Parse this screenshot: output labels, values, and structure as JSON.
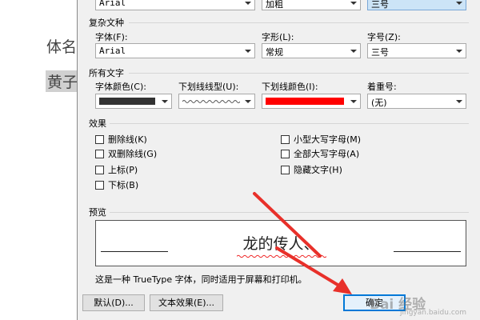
{
  "document": {
    "line1": "体名",
    "line2": "黄子"
  },
  "dialog": {
    "top_row": {
      "font_value": "Arial",
      "style_value": "加粗",
      "size_value": "三号"
    },
    "complex_script": {
      "title": "复杂文种",
      "font_label": "字体(F):",
      "font_value": "Arial",
      "style_label": "字形(L):",
      "style_value": "常规",
      "size_label": "字号(Z):",
      "size_value": "三号"
    },
    "all_text": {
      "title": "所有文字",
      "font_color_label": "字体颜色(C):",
      "underline_type_label": "下划线线型(U):",
      "underline_color_label": "下划线颜色(I):",
      "emphasis_label": "着重号:",
      "emphasis_value": "(无)",
      "font_color": "#333333",
      "underline_color": "#ff0000"
    },
    "effects": {
      "title": "效果",
      "strikethrough": "删除线(K)",
      "double_strikethrough": "双删除线(G)",
      "superscript": "上标(P)",
      "subscript": "下标(B)",
      "small_caps": "小型大写字母(M)",
      "all_caps": "全部大写字母(A)",
      "hidden": "隐藏文字(H)"
    },
    "preview": {
      "title": "预览",
      "sample_text": "龙的传人、",
      "note": "这是一种 TrueType 字体，同时适用于屏幕和打印机。"
    },
    "buttons": {
      "default_label": "默认(D)...",
      "text_effects_label": "文本效果(E)...",
      "ok_label": "确定"
    }
  },
  "annotation": {
    "arrow_color": "#e8302a"
  },
  "watermark": {
    "text": "Bai 经验",
    "sub": "jingyan.baidu.com"
  }
}
